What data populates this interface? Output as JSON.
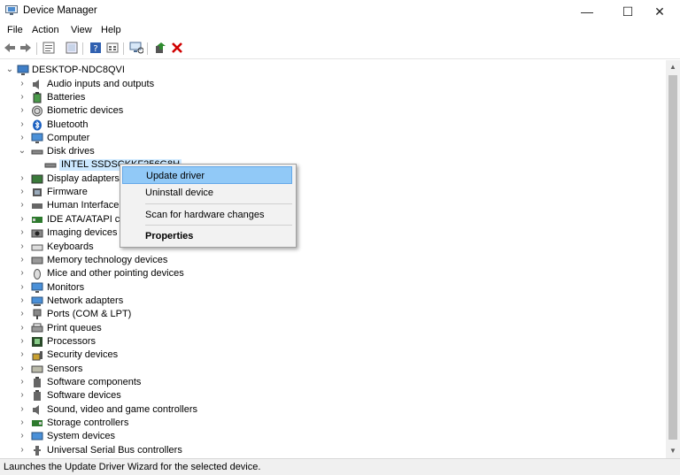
{
  "window": {
    "title": "Device Manager",
    "controls": {
      "minimize": "—",
      "maximize": "☐",
      "close": "✕"
    }
  },
  "menubar": {
    "items": [
      "File",
      "Action",
      "View",
      "Help"
    ]
  },
  "toolbar": {
    "buttons": [
      "back-icon",
      "forward-icon",
      "properties-icon",
      "show-hidden-icon",
      "help-icon",
      "view-icon",
      "scan-hardware-icon",
      "update-driver-icon",
      "uninstall-icon"
    ],
    "colors": {
      "uninstall": "#d00000",
      "update": "#2e8b2e"
    }
  },
  "tree": {
    "root": "DESKTOP-NDC8QVI",
    "categories": [
      "Audio inputs and outputs",
      "Batteries",
      "Biometric devices",
      "Bluetooth",
      "Computer",
      "Disk drives",
      "Display adapters",
      "Firmware",
      "Human Interface D",
      "IDE ATA/ATAPI cor",
      "Imaging devices",
      "Keyboards",
      "Memory technology devices",
      "Mice and other pointing devices",
      "Monitors",
      "Network adapters",
      "Ports (COM & LPT)",
      "Print queues",
      "Processors",
      "Security devices",
      "Sensors",
      "Software components",
      "Software devices",
      "Sound, video and game controllers",
      "Storage controllers",
      "System devices",
      "Universal Serial Bus controllers"
    ],
    "expanded_child": "INTEL SSDSCKKF256G8H",
    "selection_color": "#cce8ff"
  },
  "context_menu": {
    "update_driver": "Update driver",
    "uninstall_device": "Uninstall device",
    "scan_changes": "Scan for hardware changes",
    "properties": "Properties",
    "highlight_color": "#91c9f7"
  },
  "statusbar": {
    "text": "Launches the Update Driver Wizard for the selected device."
  }
}
